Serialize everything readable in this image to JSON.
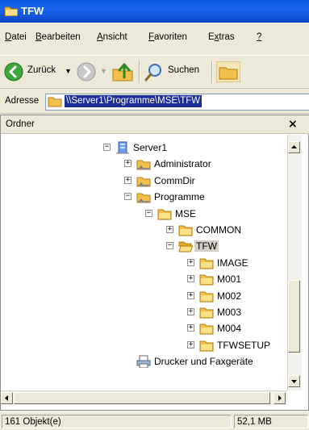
{
  "window": {
    "title": "TFW"
  },
  "menu": {
    "items": [
      "Datei",
      "Bearbeiten",
      "Ansicht",
      "Favoriten",
      "Extras",
      "?"
    ]
  },
  "toolbar": {
    "back_label": "Zurück",
    "search_label": "Suchen"
  },
  "address": {
    "label": "Adresse",
    "path": "\\\\Server1\\Programme\\MSE\\TFW"
  },
  "folder_pane": {
    "title": "Ordner",
    "close": "×",
    "tree": [
      {
        "label": "Server1",
        "icon": "server-icon",
        "expander": "−"
      },
      {
        "label": "Administrator",
        "icon": "network-folder-icon",
        "expander": "+"
      },
      {
        "label": "CommDir",
        "icon": "network-folder-icon",
        "expander": "+"
      },
      {
        "label": "Programme",
        "icon": "network-folder-icon",
        "expander": "−"
      },
      {
        "label": "MSE",
        "icon": "folder-icon",
        "expander": "−"
      },
      {
        "label": "COMMON",
        "icon": "folder-icon",
        "expander": "+"
      },
      {
        "label": "TFW",
        "icon": "open-folder-icon",
        "expander": "−",
        "selected": true
      },
      {
        "label": "IMAGE",
        "icon": "folder-icon",
        "expander": "+"
      },
      {
        "label": "M001",
        "icon": "folder-icon",
        "expander": "+"
      },
      {
        "label": "M002",
        "icon": "folder-icon",
        "expander": "+"
      },
      {
        "label": "M003",
        "icon": "folder-icon",
        "expander": "+"
      },
      {
        "label": "M004",
        "icon": "folder-icon",
        "expander": "+"
      },
      {
        "label": "TFWSETUP",
        "icon": "folder-icon",
        "expander": "+"
      },
      {
        "label": "Drucker und Faxgeräte",
        "icon": "printer-icon",
        "expander": ""
      }
    ]
  },
  "status": {
    "objects": "161 Objekt(e)",
    "size": "52,1 MB"
  },
  "colors": {
    "titlebar": "#0a58e0",
    "selection": "#1c2f98",
    "chrome": "#ece9d8"
  }
}
